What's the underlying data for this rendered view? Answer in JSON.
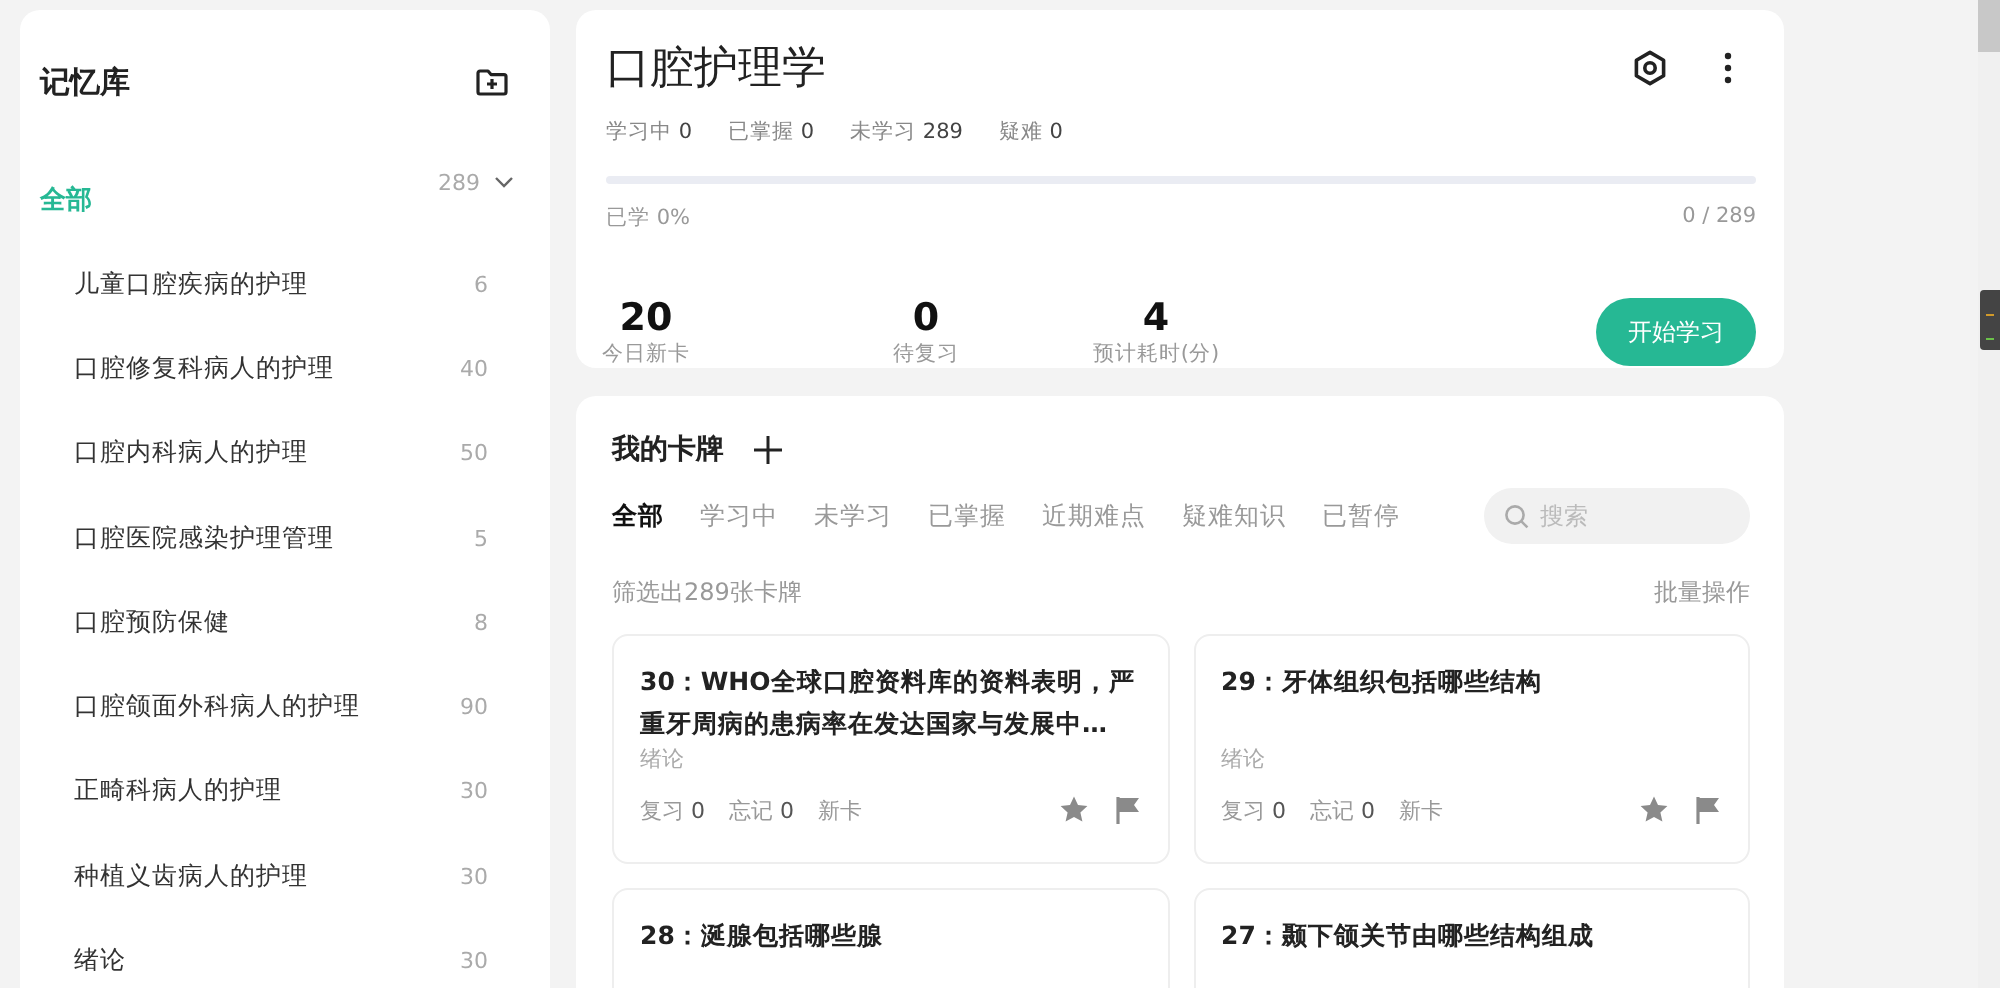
{
  "sidebar": {
    "title": "记忆库",
    "tree": [
      {
        "label": "全部",
        "count": "289",
        "selected": true,
        "expanded": true,
        "children": [
          {
            "label": "儿童口腔疾病的护理",
            "count": "6",
            "selected": false
          },
          {
            "label": "口腔修复科病人的护理",
            "count": "40",
            "selected": false
          },
          {
            "label": "口腔内科病人的护理",
            "count": "50",
            "selected": false
          },
          {
            "label": "口腔医院感染护理管理",
            "count": "5",
            "selected": false
          },
          {
            "label": "口腔预防保健",
            "count": "8",
            "selected": false
          },
          {
            "label": "口腔颌面外科病人的护理",
            "count": "90",
            "selected": false
          },
          {
            "label": "正畸科病人的护理",
            "count": "30",
            "selected": false
          },
          {
            "label": "种植义齿病人的护理",
            "count": "30",
            "selected": false
          },
          {
            "label": "绪论",
            "count": "30",
            "selected": false
          }
        ]
      }
    ]
  },
  "deck": {
    "title": "口腔护理学",
    "stats": [
      {
        "label": "学习中",
        "value": "0"
      },
      {
        "label": "已掌握",
        "value": "0"
      },
      {
        "label": "未学习",
        "value": "289"
      },
      {
        "label": "疑难",
        "value": "0"
      }
    ],
    "progress": {
      "level": 0,
      "caption": "已学 0%",
      "reading": "0 / 289"
    },
    "tiles": [
      {
        "value": "20",
        "label": "今日新卡"
      },
      {
        "value": "0",
        "label": "待复习"
      },
      {
        "value": "4",
        "label": "预计耗时(分)"
      }
    ],
    "start_button": "开始学习"
  },
  "cards_panel": {
    "title": "我的卡牌",
    "tabs": [
      {
        "label": "全部",
        "selected": true
      },
      {
        "label": "学习中",
        "selected": false
      },
      {
        "label": "未学习",
        "selected": false
      },
      {
        "label": "已掌握",
        "selected": false
      },
      {
        "label": "近期难点",
        "selected": false
      },
      {
        "label": "疑难知识",
        "selected": false
      },
      {
        "label": "已暂停",
        "selected": false
      }
    ],
    "search": {
      "placeholder": "搜索"
    },
    "filter_summary": "筛选出289张卡牌",
    "batch_action": "批量操作",
    "cards": [
      {
        "title": "30：WHO全球口腔资料库的资料表明，严重牙周病的患病率在发达国家与发展中…",
        "category": "绪论",
        "review_label": "复习",
        "review": "0",
        "forgot_label": "忘记",
        "forgot": "0",
        "status": "新卡"
      },
      {
        "title": "29：牙体组织包括哪些结构",
        "category": "绪论",
        "review_label": "复习",
        "review": "0",
        "forgot_label": "忘记",
        "forgot": "0",
        "status": "新卡"
      },
      {
        "title": "28：涎腺包括哪些腺"
      },
      {
        "title": "27：颞下颌关节由哪些结构组成"
      }
    ]
  }
}
